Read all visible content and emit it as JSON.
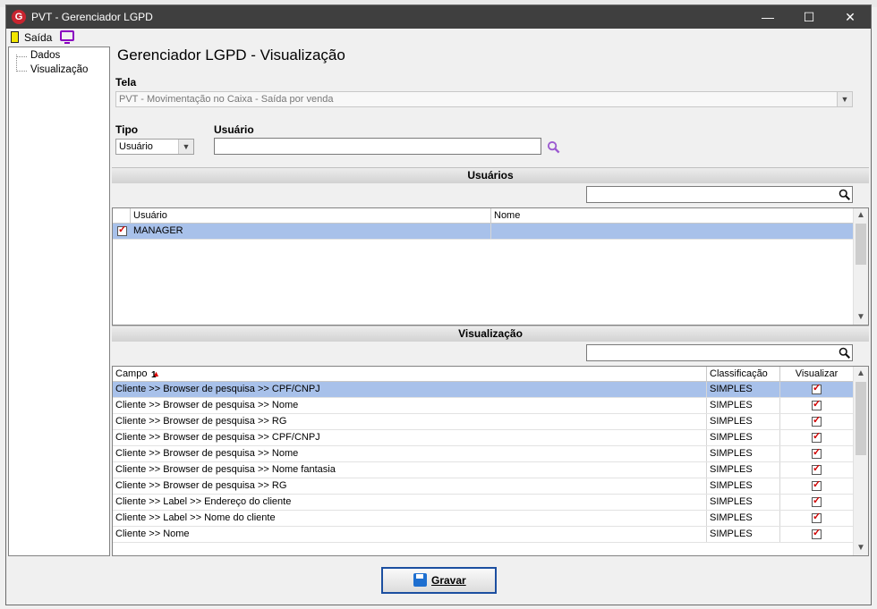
{
  "window": {
    "title": "PVT - Gerenciador LGPD",
    "icon_letter": "G"
  },
  "toolbar": {
    "exit_label": "Saída"
  },
  "tree": {
    "items": [
      "Dados",
      "Visualização"
    ]
  },
  "header": {
    "title": "Gerenciador LGPD - Visualização"
  },
  "form": {
    "tela_label": "Tela",
    "tela_value": "PVT - Movimentação no Caixa - Saída por venda",
    "tipo_label": "Tipo",
    "tipo_value": "Usuário",
    "usuario_label": "Usuário",
    "usuario_value": ""
  },
  "usuarios": {
    "section_title": "Usuários",
    "filter_value": "",
    "columns": [
      "Usuário",
      "Nome"
    ],
    "rows": [
      {
        "checked": true,
        "usuario": "MANAGER",
        "nome": ""
      }
    ]
  },
  "visualizacao": {
    "section_title": "Visualização",
    "filter_value": "",
    "columns": [
      "Campo",
      "Classificação",
      "Visualizar"
    ],
    "sort_indicator": "1",
    "rows": [
      {
        "campo": "Cliente >> Browser de pesquisa >> CPF/CNPJ",
        "classificacao": "SIMPLES",
        "visualizar": true
      },
      {
        "campo": "Cliente  >> Browser de pesquisa >> Nome",
        "classificacao": "SIMPLES",
        "visualizar": true
      },
      {
        "campo": "Cliente  >> Browser de pesquisa >> RG",
        "classificacao": "SIMPLES",
        "visualizar": true
      },
      {
        "campo": "Cliente >> Browser de pesquisa >> CPF/CNPJ",
        "classificacao": "SIMPLES",
        "visualizar": true
      },
      {
        "campo": "Cliente >> Browser de pesquisa >> Nome",
        "classificacao": "SIMPLES",
        "visualizar": true
      },
      {
        "campo": "Cliente >> Browser de pesquisa >> Nome fantasia",
        "classificacao": "SIMPLES",
        "visualizar": true
      },
      {
        "campo": "Cliente >> Browser de pesquisa >> RG",
        "classificacao": "SIMPLES",
        "visualizar": true
      },
      {
        "campo": "Cliente >> Label >> Endereço do cliente",
        "classificacao": "SIMPLES",
        "visualizar": true
      },
      {
        "campo": "Cliente >> Label >> Nome do cliente",
        "classificacao": "SIMPLES",
        "visualizar": true
      },
      {
        "campo": "Cliente >> Nome",
        "classificacao": "SIMPLES",
        "visualizar": true
      }
    ]
  },
  "footer": {
    "save_label": "Gravar"
  },
  "colors": {
    "selection": "#a8c1ea",
    "titlebar": "#3f3f3f",
    "check": "#d00000",
    "accent": "#1c4fa0"
  },
  "icons": [
    "app-logo-icon",
    "exit-door-icon",
    "monitor-icon",
    "search-icon",
    "floppy-disk-icon",
    "sort-arrow-icon"
  ]
}
